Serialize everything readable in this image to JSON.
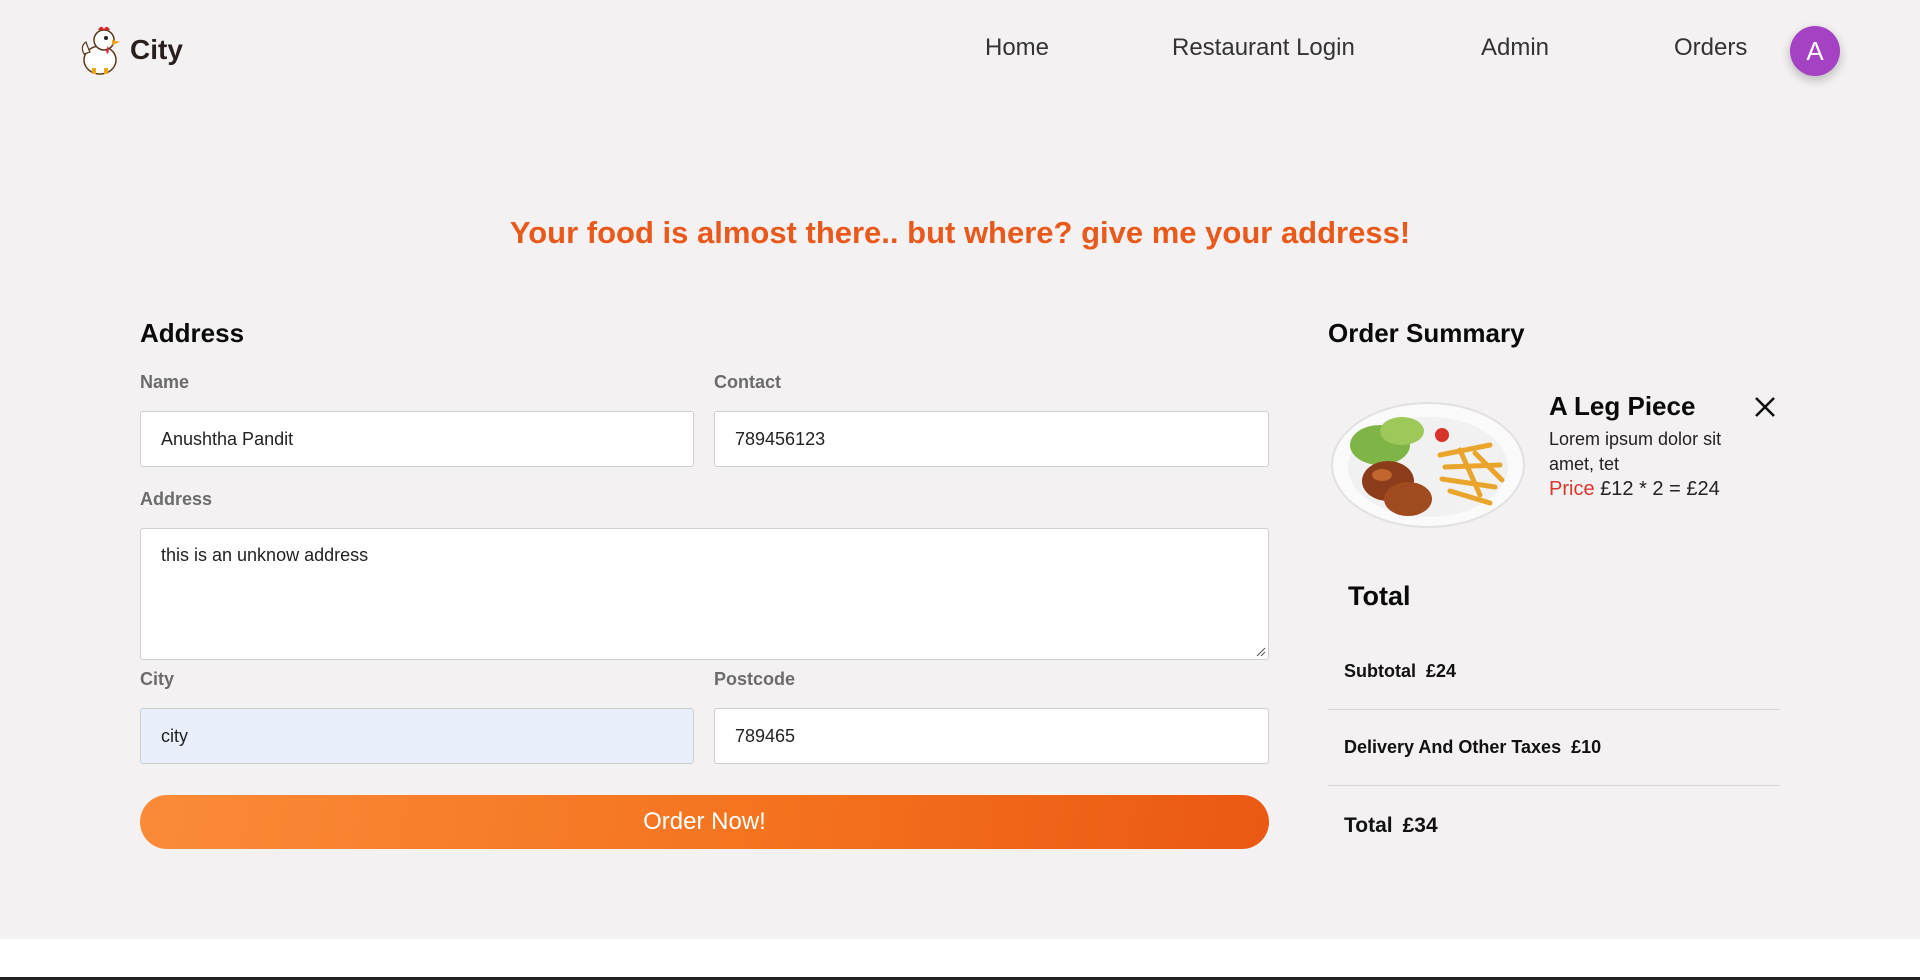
{
  "header": {
    "brand": "City",
    "nav": [
      "Home",
      "Restaurant Login",
      "Admin",
      "Orders"
    ],
    "avatar_letter": "A"
  },
  "headline": "Your food is almost there.. but where? give me your address!",
  "address_form": {
    "title": "Address",
    "name_label": "Name",
    "name_value": "Anushtha Pandit",
    "contact_label": "Contact",
    "contact_value": "789456123",
    "address_label": "Address",
    "address_value": "this is an unknow address",
    "city_label": "City",
    "city_value": "city",
    "postcode_label": "Postcode",
    "postcode_value": "789465",
    "submit_label": "Order Now!"
  },
  "order_summary": {
    "title": "Order Summary",
    "item": {
      "name": "A Leg Piece",
      "description": "Lorem ipsum dolor sit amet, tet",
      "price_label": "Price",
      "price_calc": "£12 * 2 = £24"
    },
    "total_heading": "Total",
    "subtotal_label": "Subtotal",
    "subtotal_value": "£24",
    "delivery_label": "Delivery And Other Taxes",
    "delivery_value": "£10",
    "total_label": "Total",
    "total_value": "£34"
  },
  "colors": {
    "accent": "#e8591b",
    "avatar": "#a542c4",
    "price_label": "#d9372b",
    "background": "#f4f1f2"
  },
  "icons": [
    "chicken-logo-icon",
    "close-icon"
  ]
}
